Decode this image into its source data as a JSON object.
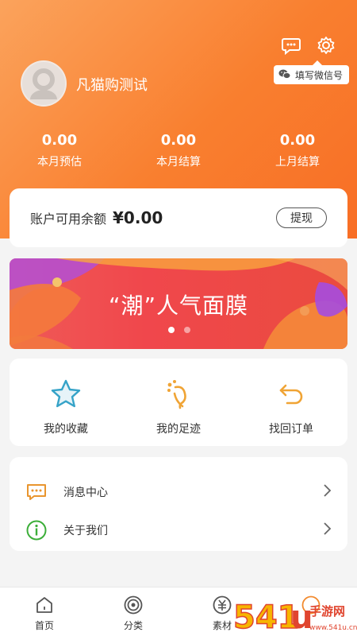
{
  "header": {
    "username": "凡猫购测试",
    "wechat_tip": "填写微信号",
    "colors": {
      "gradient_start": "#fba35c",
      "gradient_end": "#f86e25"
    },
    "icons": [
      "message-icon",
      "settings-icon",
      "wechat-icon"
    ]
  },
  "stats": [
    {
      "value": "0.00",
      "label": "本月预估"
    },
    {
      "value": "0.00",
      "label": "本月结算"
    },
    {
      "value": "0.00",
      "label": "上月结算"
    }
  ],
  "balance": {
    "label": "账户可用余额",
    "amount": "¥0.00",
    "withdraw_label": "提现"
  },
  "banner": {
    "text": "“潮”人气面膜",
    "active_dot": 1,
    "dot_count": 2
  },
  "quick_actions": [
    {
      "label": "我的收藏",
      "icon": "star-icon"
    },
    {
      "label": "我的足迹",
      "icon": "footprint-icon"
    },
    {
      "label": "找回订单",
      "icon": "undo-icon"
    }
  ],
  "list": [
    {
      "label": "消息中心",
      "icon": "message-center-icon"
    },
    {
      "label": "关于我们",
      "icon": "info-icon"
    }
  ],
  "tabbar": [
    {
      "label": "首页",
      "icon": "home-icon"
    },
    {
      "label": "分类",
      "icon": "category-icon"
    },
    {
      "label": "素材",
      "icon": "material-icon"
    },
    {
      "label": "",
      "icon": "profile-icon"
    }
  ],
  "watermark": {
    "text": "541u手游网",
    "sub": "www.541u.cn"
  }
}
